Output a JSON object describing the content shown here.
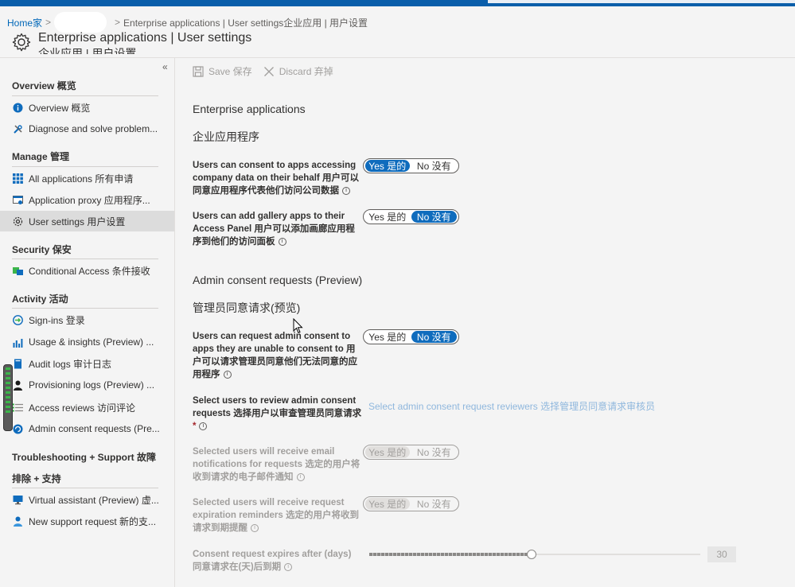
{
  "breadcrumb": {
    "home": "Home家",
    "current": "Enterprise applications | User settings企业应用 | 用户设置"
  },
  "header": {
    "title": "Enterprise applications | User settings",
    "subtitle": "企业应用 | 用户设置"
  },
  "toolbar": {
    "save": "Save 保存",
    "discard": "Discard 弃掉"
  },
  "sidebar": {
    "collapse": "«",
    "sections": {
      "overview": "Overview 概览",
      "manage": "Manage 管理",
      "security": "Security 保安",
      "activity": "Activity 活动",
      "troubleshooting_1": "Troubleshooting + Support 故障",
      "troubleshooting_2": "排除 + 支持"
    },
    "items": {
      "overview": "Overview 概览",
      "diagnose": "Diagnose and solve problem...",
      "all_apps": "All applications 所有申请",
      "app_proxy": "Application proxy 应用程序...",
      "user_settings": "User settings 用户设置",
      "conditional_access": "Conditional Access 条件接收",
      "signins": "Sign-ins 登录",
      "usage": "Usage & insights (Preview) ...",
      "audit": "Audit logs 审计日志",
      "provisioning": "Provisioning logs (Preview) ...",
      "access_reviews": "Access reviews 访问评论",
      "admin_consent": "Admin consent requests (Pre...",
      "virtual_assistant": "Virtual assistant (Preview) 虚...",
      "new_support": "New support request 新的支..."
    }
  },
  "main": {
    "section1_en": "Enterprise applications",
    "section1_zh": "企业应用程序",
    "consent_label": "Users can consent to apps accessing company data on their behalf 用户可以同意应用程序代表他们访问公司数据",
    "gallery_label": "Users can add gallery apps to their Access Panel 用户可以添加画廊应用程序到他们的访问面板",
    "section2_en": "Admin consent requests (Preview)",
    "section2_zh": "管理员同意请求(预览)",
    "request_label": "Users can request admin consent to apps they are unable to consent to 用户可以请求管理员同意他们无法同意的应用程序",
    "reviewers_label": "Select users to review admin consent requests 选择用户以审查管理员同意请求",
    "reviewers_link": "Select admin consent request reviewers 选择管理员同意请求审核员",
    "email_label": "Selected users will receive email notifications for requests 选定的用户将收到请求的电子邮件通知",
    "reminder_label": "Selected users will receive request expiration reminders 选定的用户将收到请求到期提醒",
    "expires_label": "Consent request expires after (days) 同意请求在(天)后到期",
    "expires_value": "30",
    "expires_fraction": 0.49,
    "toggles": {
      "yes": "Yes 是的",
      "no": "No 没有",
      "consent": "yes",
      "gallery": "no",
      "request": "no",
      "email": "yes",
      "reminder": "yes"
    }
  },
  "colors": {
    "accent": "#0f6cbd",
    "topbar": "#0a5eaa",
    "link": "#0067b8"
  }
}
